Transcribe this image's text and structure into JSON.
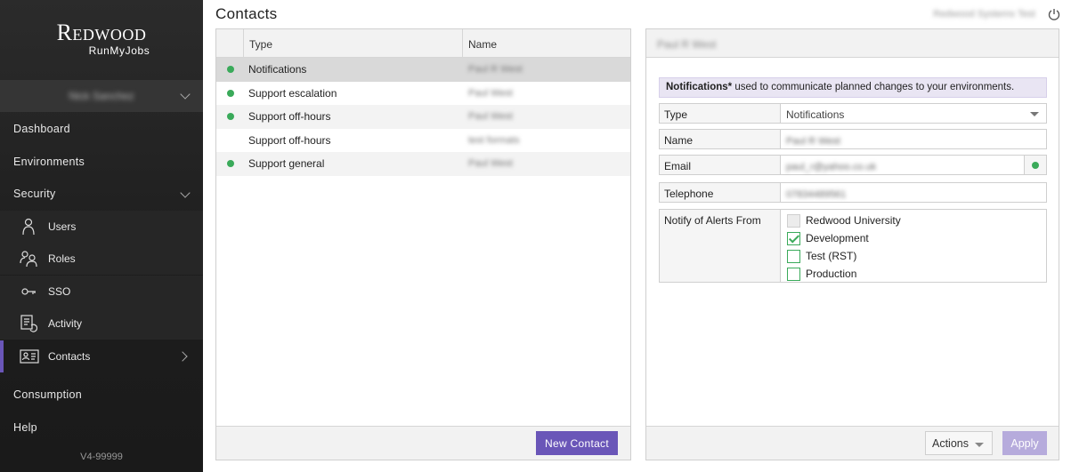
{
  "brand": {
    "name": "Redwood",
    "product": "RunMyJobs"
  },
  "user": {
    "name": "Nick Sanchez"
  },
  "nav": {
    "dashboard": "Dashboard",
    "environments": "Environments",
    "security": "Security",
    "security_items": [
      {
        "label": "Users",
        "icon": "user-icon"
      },
      {
        "label": "Roles",
        "icon": "roles-icon"
      },
      {
        "label": "SSO",
        "icon": "key-icon"
      },
      {
        "label": "Activity",
        "icon": "activity-icon"
      },
      {
        "label": "Contacts",
        "icon": "contact-card-icon"
      }
    ],
    "consumption": "Consumption",
    "help": "Help"
  },
  "version": "V4-99999",
  "page": {
    "title": "Contacts",
    "tenant": "Redwood Systems Test"
  },
  "contacts_table": {
    "columns": {
      "type": "Type",
      "name": "Name"
    },
    "rows": [
      {
        "type": "Notifications",
        "name": "Paul R West",
        "active": true
      },
      {
        "type": "Support escalation",
        "name": "Paul West",
        "active": true
      },
      {
        "type": "Support off-hours",
        "name": "Paul West",
        "active": true
      },
      {
        "type": "Support off-hours",
        "name": "test formats",
        "active": false
      },
      {
        "type": "Support general",
        "name": "Paul West",
        "active": true
      }
    ],
    "new_button": "New Contact"
  },
  "detail": {
    "header": "Paul R West",
    "info_bold": "Notifications*",
    "info_text": " used to communicate planned changes to your environments.",
    "fields": {
      "type_label": "Type",
      "type_value": "Notifications",
      "name_label": "Name",
      "name_value": "Paul R West",
      "email_label": "Email",
      "email_value": "paul_r@yahoo.co.uk",
      "telephone_label": "Telephone",
      "telephone_value": "07834489561",
      "notify_label": "Notify of Alerts From"
    },
    "alert_sources": [
      {
        "label": "Redwood University",
        "checked": false,
        "disabled": true
      },
      {
        "label": "Development",
        "checked": true,
        "disabled": false
      },
      {
        "label": "Test (RST)",
        "checked": false,
        "disabled": false
      },
      {
        "label": "Production",
        "checked": false,
        "disabled": false
      }
    ],
    "actions_button": "Actions",
    "apply_button": "Apply"
  },
  "colors": {
    "accent": "#6a56b8",
    "status_green": "#3aaa5a",
    "sidebar_bg": "#1f1f1f"
  }
}
